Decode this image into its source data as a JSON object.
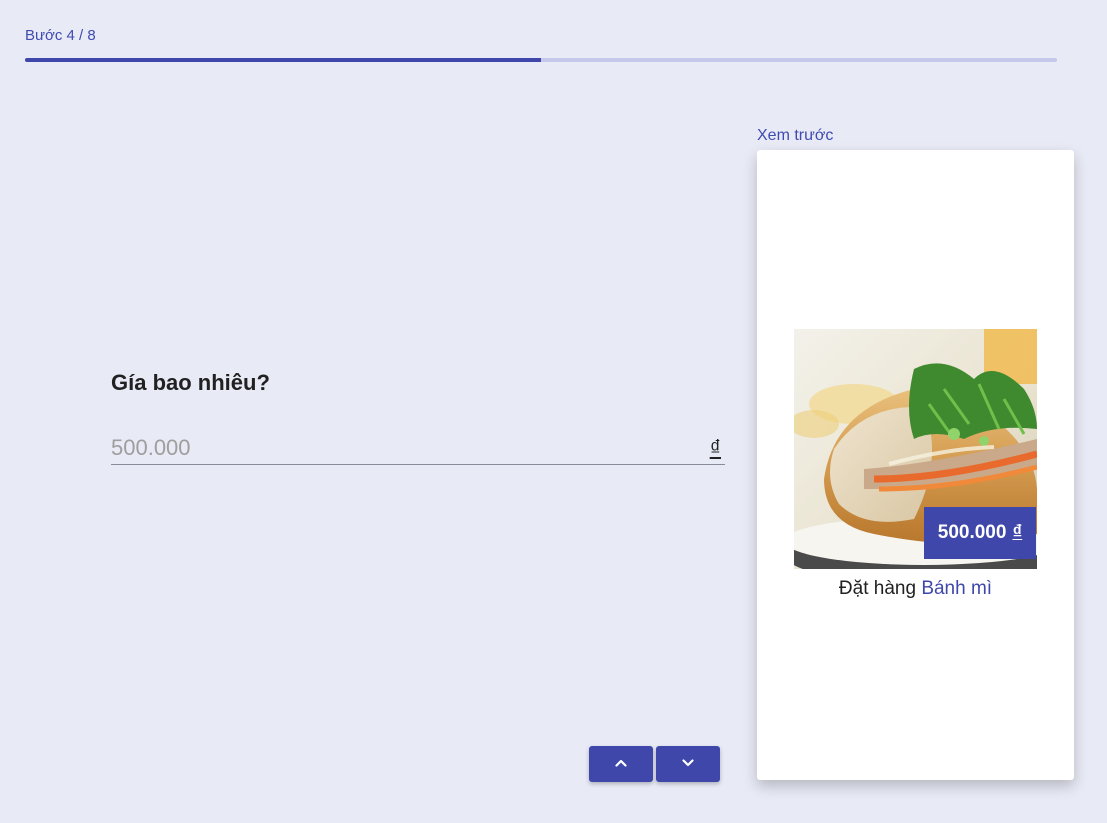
{
  "step": {
    "label": "Bước 4 / 8",
    "progress": 0.5
  },
  "question": {
    "title": "Gía bao nhiêu?"
  },
  "price_input": {
    "placeholder": "500.000",
    "value": "",
    "currency": "₫"
  },
  "nav": {
    "up_icon": "chevron-up-icon",
    "down_icon": "chevron-down-icon"
  },
  "preview": {
    "label": "Xem trước",
    "price_value": "500.000",
    "price_currency": "₫",
    "order_prefix": "Đặt hàng",
    "product_name": "Bánh mì",
    "image": "banh-mi-sandwich-image"
  },
  "colors": {
    "accent": "#3f48aa",
    "background": "#e8eaf6",
    "progress_track": "#c5c8ea"
  }
}
